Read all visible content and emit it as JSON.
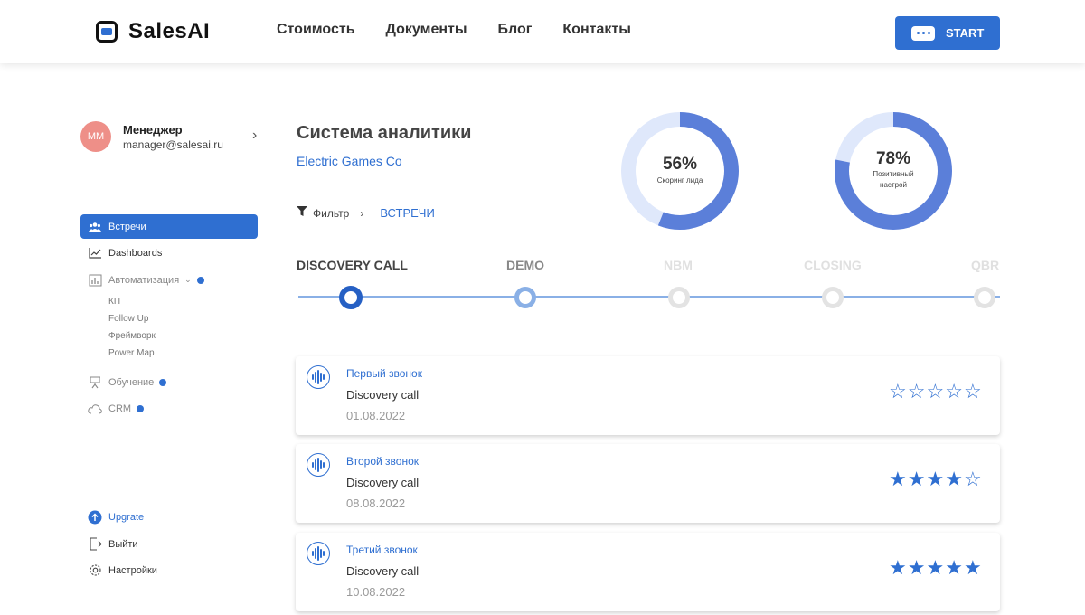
{
  "header": {
    "logo_text": "SalesAI",
    "nav": [
      "Стоимость",
      "Документы",
      "Блог",
      "Контакты"
    ],
    "start_label": "START"
  },
  "profile": {
    "initials": "MM",
    "name": "Менеджер",
    "email": "manager@salesai.ru"
  },
  "sidebar": {
    "items": [
      {
        "label": "Встречи",
        "icon": "people-icon"
      },
      {
        "label": "Dashboards",
        "icon": "chart-line-icon"
      },
      {
        "label": "Автоматизация",
        "icon": "bar-chart-icon"
      },
      {
        "label": "Обучение",
        "icon": "easel-icon"
      },
      {
        "label": "CRM",
        "icon": "cloud-icon"
      }
    ],
    "subitems": [
      "КП",
      "Follow Up",
      "Фреймворк",
      "Power Map"
    ],
    "bottom": [
      {
        "label": "Upgrate",
        "icon": "upgrade-icon"
      },
      {
        "label": "Выйти",
        "icon": "logout-icon"
      },
      {
        "label": "Настройки",
        "icon": "gear-icon"
      }
    ]
  },
  "main": {
    "title": "Система аналитики",
    "company": "Electric Games Co",
    "filter_label": "Фильтр",
    "filter_crumb": "ВСТРЕЧИ",
    "metrics": [
      {
        "value": "56%",
        "label": "Скоринг лида",
        "fraction": 0.56
      },
      {
        "value": "78%",
        "label_line1": "Позитивный",
        "label_line2": "настрой",
        "fraction": 0.78
      }
    ],
    "stages": [
      {
        "label": "DISCOVERY CALL",
        "state": "current"
      },
      {
        "label": "DEMO",
        "state": "next"
      },
      {
        "label": "NBM",
        "state": "inactive"
      },
      {
        "label": "CLOSING",
        "state": "inactive"
      },
      {
        "label": "QBR",
        "state": "inactive"
      }
    ],
    "calls": [
      {
        "title": "Первый звонок",
        "type": "Discovery call",
        "date": "01.08.2022",
        "rating": 0
      },
      {
        "title": "Второй звонок",
        "type": "Discovery call",
        "date": "08.08.2022",
        "rating": 4
      },
      {
        "title": "Третий звонок",
        "type": "Discovery call",
        "date": "10.08.2022",
        "rating": 5
      }
    ]
  },
  "colors": {
    "accent": "#2f6fd1",
    "donut_track": "#dfe8fb",
    "donut_fill": "#5b7fd9",
    "avatar": "#ee8f88"
  }
}
